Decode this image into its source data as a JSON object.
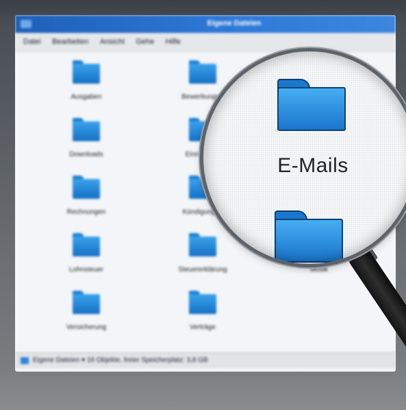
{
  "window": {
    "title": "Eigene Dateien",
    "menu": [
      "Datei",
      "Bearbeiten",
      "Ansicht",
      "Gehe",
      "Hilfe"
    ]
  },
  "folders": [
    {
      "label": "Ausgaben"
    },
    {
      "label": "Bewerbungen"
    },
    {
      "label": "Downloads"
    },
    {
      "label": "Einnahmen"
    },
    {
      "label": "Rechnungen"
    },
    {
      "label": "Kündigungen"
    },
    {
      "label": "Lohnsteuer"
    },
    {
      "label": "Steuererklärung"
    },
    {
      "label": "Musik"
    },
    {
      "label": "Versicherung"
    },
    {
      "label": "Verträge"
    }
  ],
  "status": {
    "text": "Eigene Dateien ▾ 16 Objekte, freier Speicherplatz: 3,8 GB"
  },
  "magnified": {
    "label": "E-Mails"
  },
  "colors": {
    "titlebar": "#2f7ad8",
    "folder": "#2a8fe0",
    "folder_outline": "#0d3f75"
  }
}
